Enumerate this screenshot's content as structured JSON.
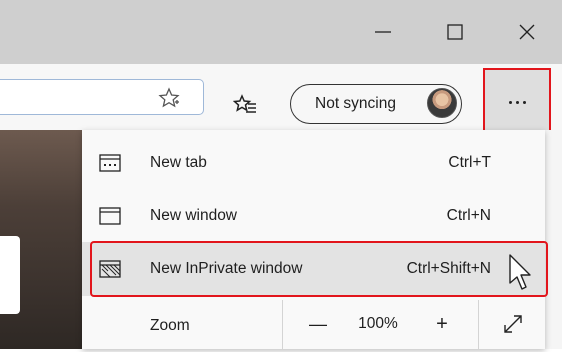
{
  "window": {
    "minimize_icon": "minimize-icon",
    "maximize_icon": "maximize-icon",
    "close_icon": "close-icon"
  },
  "toolbar": {
    "favorite_icon": "star-add-icon",
    "favorites_icon": "favorites-list-icon",
    "sync_label": "Not syncing",
    "more_icon": "more-dots-icon"
  },
  "menu": {
    "items": [
      {
        "label": "New tab",
        "shortcut": "Ctrl+T",
        "icon": "new-tab-icon"
      },
      {
        "label": "New window",
        "shortcut": "Ctrl+N",
        "icon": "new-window-icon"
      },
      {
        "label": "New InPrivate window",
        "shortcut": "Ctrl+Shift+N",
        "icon": "inprivate-icon"
      }
    ],
    "zoom": {
      "label": "Zoom",
      "minus": "—",
      "value": "100%",
      "plus": "+",
      "fullscreen_icon": "fullscreen-icon"
    }
  },
  "colors": {
    "highlight_outline": "#e2151c",
    "titlebar": "#cfcfcf",
    "menu_bg": "#f9f9f9"
  }
}
